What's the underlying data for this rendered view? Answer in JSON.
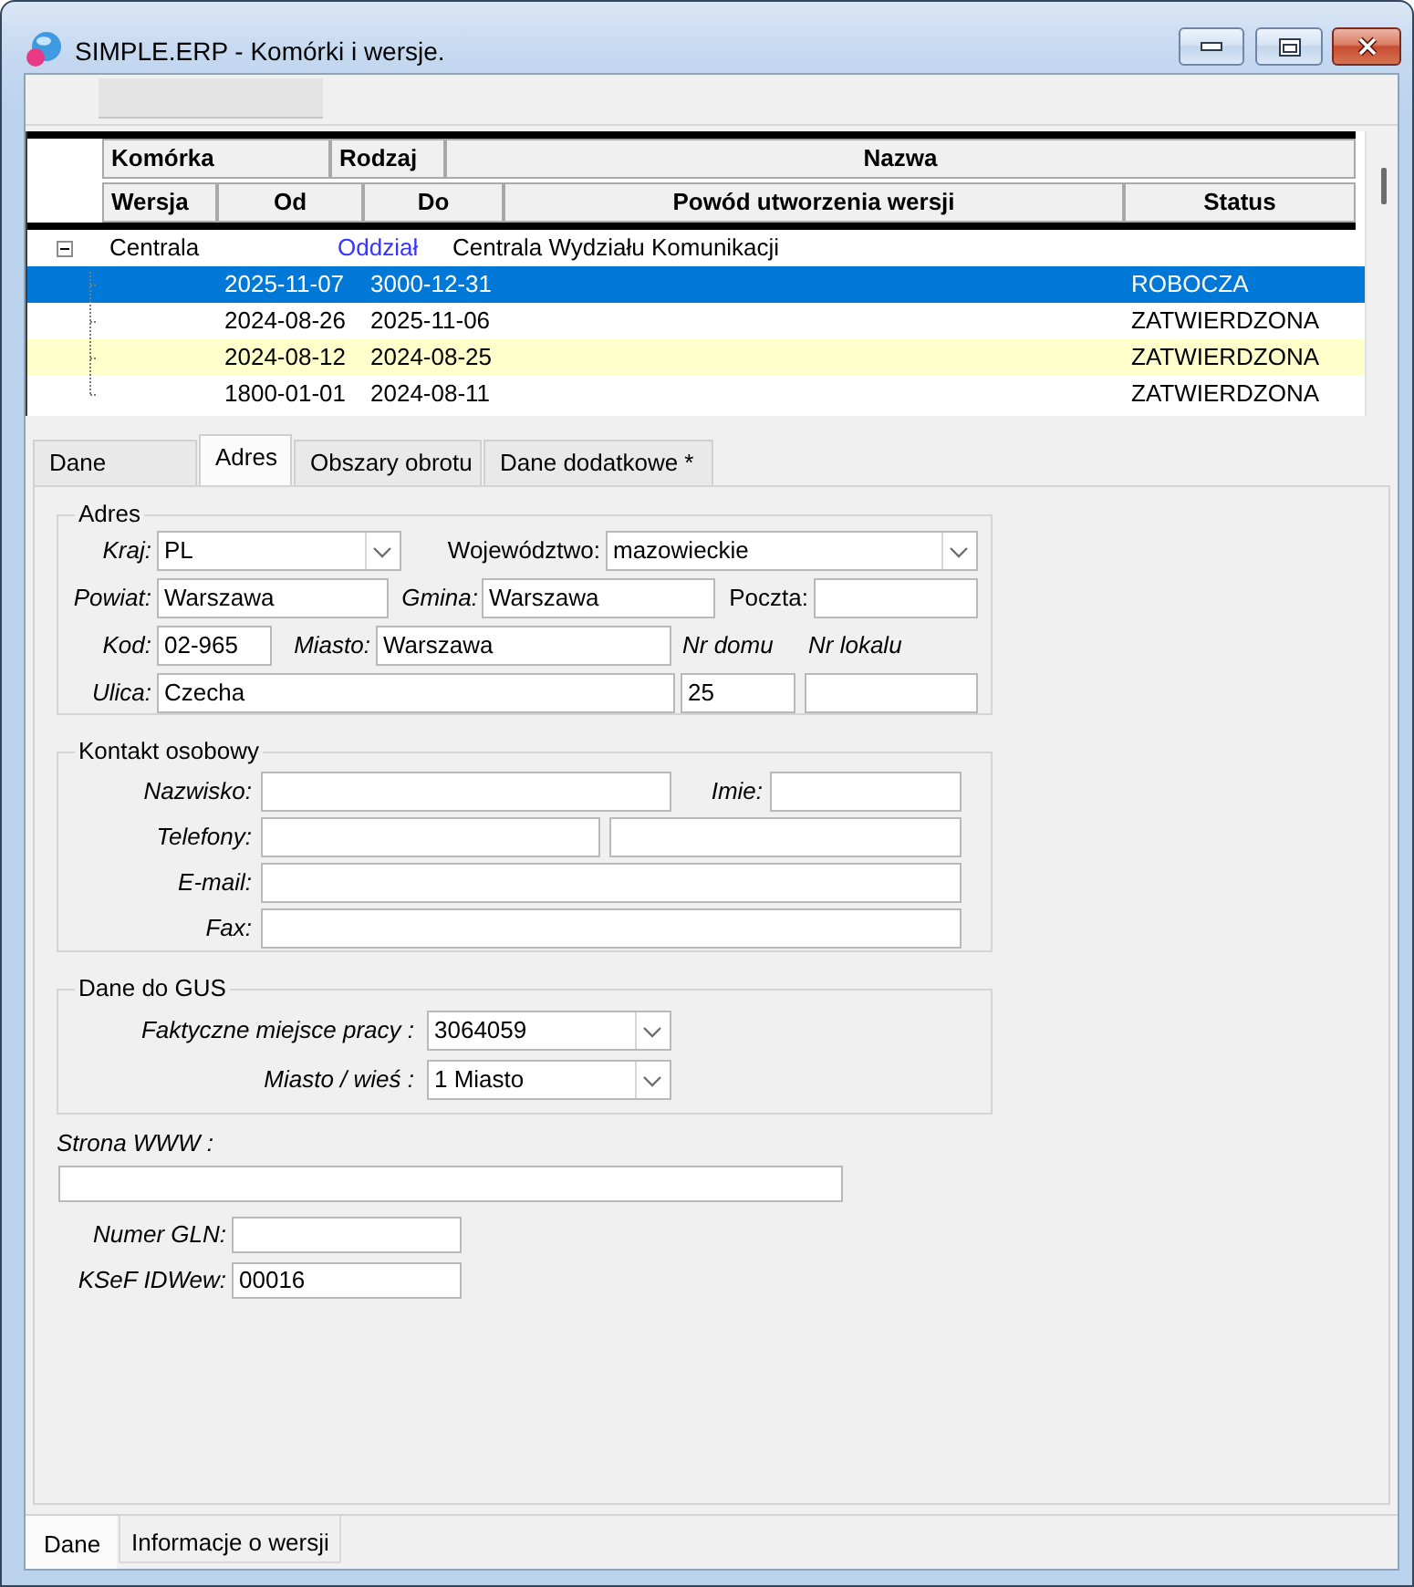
{
  "window": {
    "title": "SIMPLE.ERP - Komórki i wersje."
  },
  "grid": {
    "header_top": [
      "Komórka",
      "Rodzaj",
      "Nazwa"
    ],
    "header_bottom": [
      "Wersja",
      "Od",
      "Do",
      "Powód utworzenia wersji",
      "Status"
    ],
    "tree": [
      {
        "cell": "Centrala",
        "type": "Oddział",
        "name": "Centrala Wydziału Komunikacji",
        "expanded": true,
        "selected": false,
        "highlighted": false,
        "children": [
          {
            "from": "2025-11-07",
            "to": "3000-12-31",
            "status": "ROBOCZA",
            "selected": true,
            "highlighted": false
          },
          {
            "from": "2024-08-26",
            "to": "2025-11-06",
            "status": "ZATWIERDZONA",
            "selected": false,
            "highlighted": false
          },
          {
            "from": "2024-08-12",
            "to": "2024-08-25",
            "status": "ZATWIERDZONA",
            "selected": false,
            "highlighted": true
          },
          {
            "from": "1800-01-01",
            "to": "2024-08-11",
            "status": "ZATWIERDZONA",
            "selected": false,
            "highlighted": false
          }
        ]
      }
    ]
  },
  "tabs": [
    {
      "label": "Dane",
      "selected": false
    },
    {
      "label": "Adres",
      "selected": true
    },
    {
      "label": "Obszary obrotu",
      "selected": false
    },
    {
      "label": "Dane dodatkowe *",
      "selected": false
    }
  ],
  "address": {
    "title": "Adres",
    "country": {
      "label": "Kraj:",
      "value": "PL"
    },
    "voivodeship": {
      "label": "Województwo:",
      "value": "mazowieckie"
    },
    "county": {
      "label": "Powiat:",
      "value": "Warszawa"
    },
    "commune": {
      "label": "Gmina:",
      "value": "Warszawa"
    },
    "post_office": {
      "label": "Poczta:"
    },
    "postal_code": {
      "label": "Kod:",
      "value": "02-965"
    },
    "city": {
      "label": "Miasto:",
      "value": "Warszawa"
    },
    "house_number": {
      "label": "Nr domu",
      "value": "25"
    },
    "flat_number": {
      "label": "Nr lokalu"
    },
    "street": {
      "label": "Ulica:",
      "value": "Czecha"
    }
  },
  "contact": {
    "title": "Kontakt osobowy",
    "surname": {
      "label": "Nazwisko:"
    },
    "first_name": {
      "label": "Imie:"
    },
    "phones": {
      "label": "Telefony:"
    },
    "email": {
      "label": "E-mail:"
    },
    "fax": {
      "label": "Fax:"
    }
  },
  "gus": {
    "title": "Dane do GUS",
    "workplace": {
      "label": "Faktyczne miejsce pracy :",
      "value": "3064059"
    },
    "locality": {
      "label": "Miasto / wieś :",
      "value": "1 Miasto"
    }
  },
  "website": {
    "label": "Strona WWW :"
  },
  "gln": {
    "label": "Numer GLN:"
  },
  "ksef_id": {
    "label": "KSeF IDWew:",
    "value": "00016"
  },
  "bottom_tabs": [
    {
      "label": "Dane",
      "selected": true
    },
    {
      "label": "Informacje o wersji",
      "selected": false
    }
  ]
}
